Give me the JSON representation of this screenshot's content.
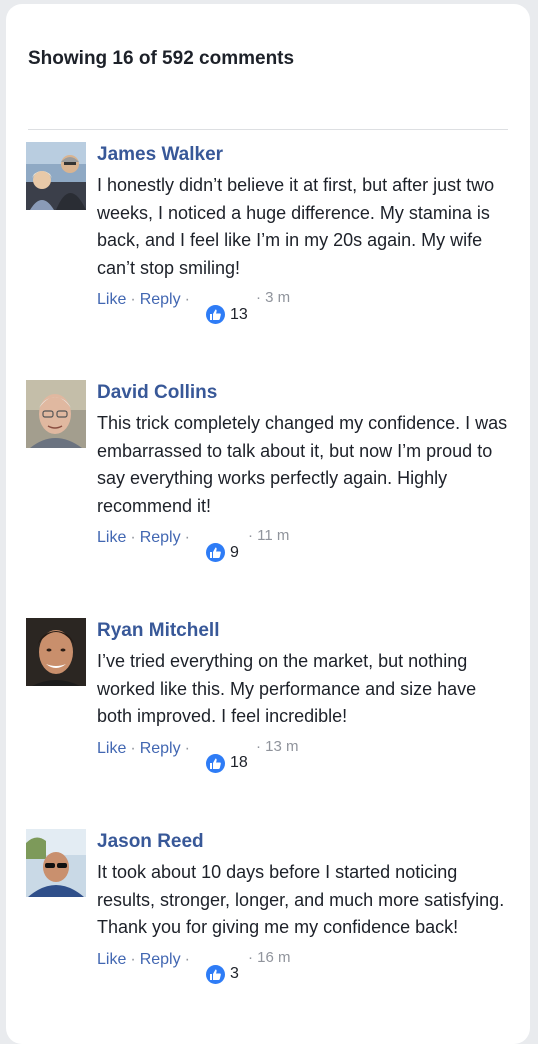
{
  "header": {
    "count_label": "Showing 16 of 592 comments"
  },
  "actions": {
    "like_label": "Like",
    "reply_label": "Reply",
    "separator": "·"
  },
  "colors": {
    "author_blue": "#385898",
    "link_blue": "#4267b2",
    "like_blue": "#2e7cf6",
    "muted_gray": "#90949c"
  },
  "comments": [
    {
      "author": "James Walker",
      "text": "I honestly didn’t believe it at first, but after just two weeks, I noticed a huge difference. My stamina is back, and I feel like I’m in my 20s again. My wife can’t stop smiling!",
      "likes": "13",
      "time": "· 3 m",
      "avatar_icon": "couple-photo-avatar"
    },
    {
      "author": "David Collins",
      "text": "This trick completely changed my confidence. I was embarrassed to talk about it, but now I’m proud to say everything works perfectly again. Highly recommend it!",
      "likes": "9",
      "time": "· 11 m",
      "avatar_icon": "older-man-photo-avatar"
    },
    {
      "author": "Ryan Mitchell",
      "text": "I’ve tried everything on the market, but nothing worked like this. My performance and size have both improved. I feel incredible!",
      "likes": "18",
      "time": "· 13 m",
      "avatar_icon": "man-photo-avatar"
    },
    {
      "author": "Jason Reed",
      "text": "It took about 10 days before I started noticing results, stronger, longer, and much more satisfying. Thank you for giving me my confidence back!",
      "likes": "3",
      "time": "· 16 m",
      "avatar_icon": "man-sunglasses-photo-avatar"
    }
  ]
}
